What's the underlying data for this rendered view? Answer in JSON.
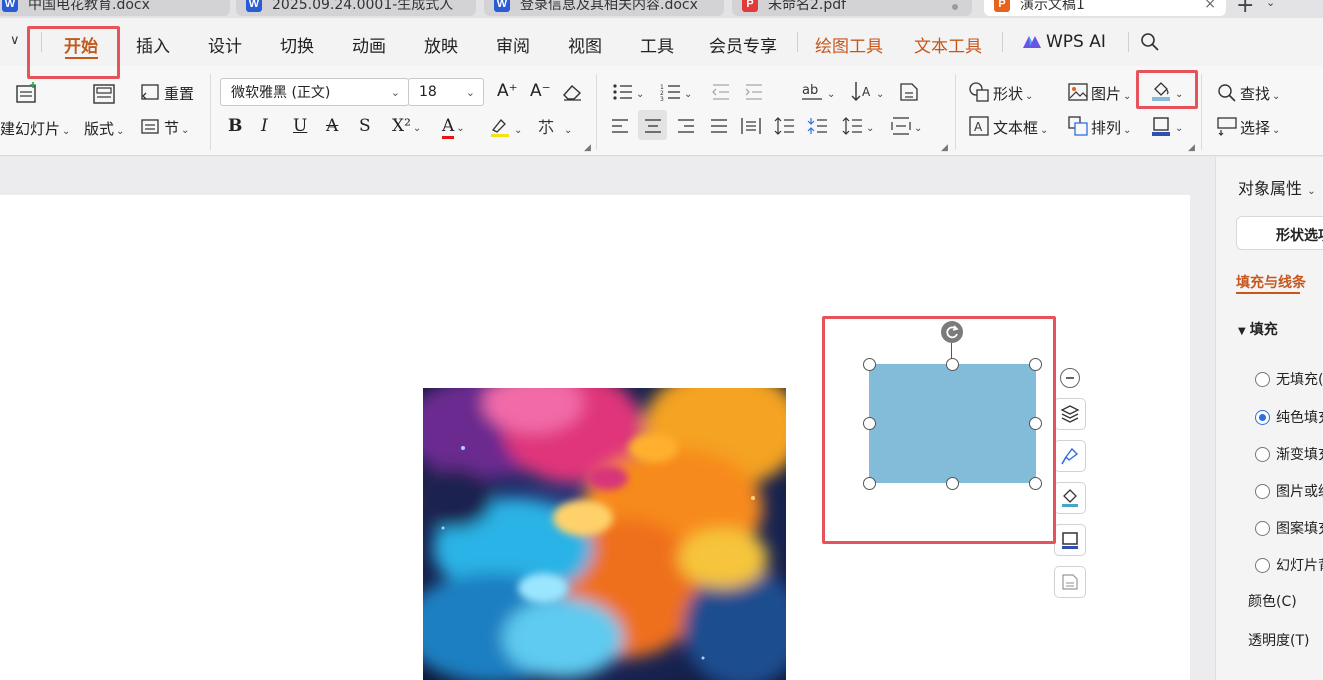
{
  "tabs": [
    {
      "label": "中国电花教育.docx",
      "icon": "W",
      "color": "#2a5bd7"
    },
    {
      "label": "2025.09.24.0001-生成式人",
      "icon": "W",
      "color": "#2a5bd7"
    },
    {
      "label": "登录信息及其相关内容.docx",
      "icon": "W",
      "color": "#2a5bd7"
    },
    {
      "label": "未命名2.pdf",
      "icon": "P",
      "color": "#e03a3a"
    },
    {
      "label": "演示文稿1",
      "icon": "P",
      "color": "#e8621f"
    }
  ],
  "menu": {
    "items": [
      "开始",
      "插入",
      "设计",
      "切换",
      "动画",
      "放映",
      "审阅",
      "视图",
      "工具",
      "会员专享",
      "绘图工具",
      "文本工具",
      "WPS AI"
    ],
    "active": "开始"
  },
  "ribbon": {
    "new_slide": "建幻灯片",
    "layout": "版式",
    "reset": "重置",
    "section": "节",
    "font_name": "微软雅黑 (正文)",
    "font_size": "18",
    "bold": "B",
    "italic": "I",
    "underline": "U",
    "strike": "A",
    "shadow": "S",
    "superscript": "X²",
    "font_color_letter": "A",
    "shape": "形状",
    "picture": "图片",
    "textbox": "文本框",
    "arrange": "排列",
    "find": "查找",
    "select": "选择",
    "grow": "A⁺",
    "shrink": "A⁻"
  },
  "panel": {
    "title": "对象属性",
    "tab": "形状选项",
    "section": "填充与线条",
    "fill_header": "填充",
    "fill_options": [
      "无填充(",
      "纯色填充",
      "渐变填充",
      "图片或纹",
      "图案填充",
      "幻灯片背"
    ],
    "selected_option": 1,
    "color_label": "颜色(C)",
    "transparency_label": "透明度(T)"
  },
  "colors": {
    "accent": "#c8561b",
    "shape_fill": "#82bcd8",
    "highlight_border": "#e8525a"
  }
}
